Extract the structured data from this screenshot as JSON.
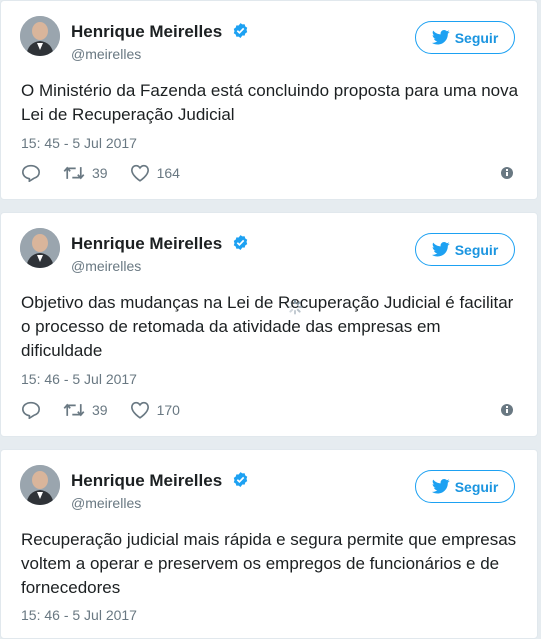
{
  "colors": {
    "accent": "#1da1f2",
    "text": "#1c2022",
    "muted": "#697882",
    "background": "#e6ecf0"
  },
  "icons": {
    "verified": "verified-badge-icon",
    "bird": "twitter-bird-icon",
    "reply": "reply-icon",
    "retweet": "retweet-icon",
    "like": "heart-icon",
    "info": "info-icon",
    "loading": "loading-spinner-icon"
  },
  "tweets": [
    {
      "author": "Henrique Meirelles",
      "handle": "@meirelles",
      "follow_label": "Seguir",
      "text": "O Ministério da Fazenda está concluindo proposta para uma nova Lei de Recuperação Judicial",
      "timestamp": "15: 45 - 5 Jul 2017",
      "retweets": "39",
      "likes": "164"
    },
    {
      "author": "Henrique Meirelles",
      "handle": "@meirelles",
      "follow_label": "Seguir",
      "text": "Objetivo das mudanças na Lei de Recuperação Judicial é facilitar o processo de retomada da atividade das empresas em dificuldade",
      "timestamp": "15: 46 - 5 Jul 2017",
      "retweets": "39",
      "likes": "170"
    },
    {
      "author": "Henrique Meirelles",
      "handle": "@meirelles",
      "follow_label": "Seguir",
      "text": "Recuperação judicial mais rápida e segura permite que empresas voltem a operar e preservem os empregos de funcionários e de fornecedores",
      "timestamp": "15: 46 - 5 Jul 2017"
    }
  ]
}
